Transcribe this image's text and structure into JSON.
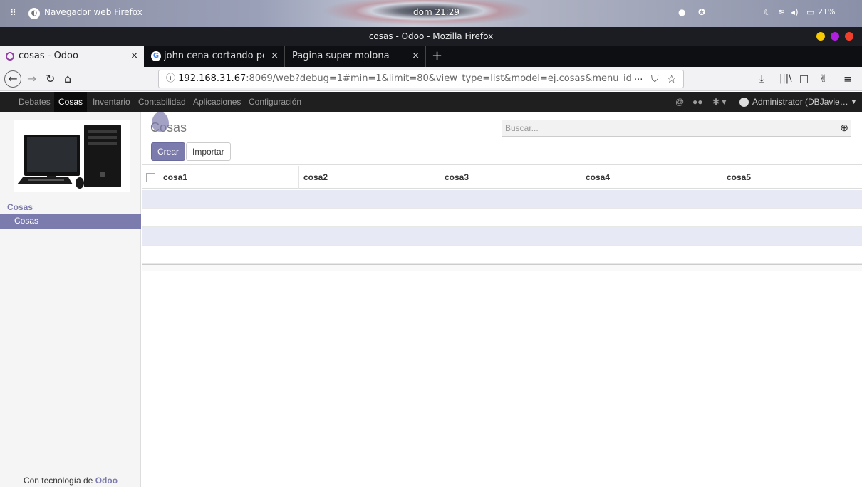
{
  "os_bar": {
    "activities_icon": "grid-icon",
    "app_name": "Navegador web Firefox",
    "clock": "dom 21:29",
    "battery": "21%"
  },
  "window": {
    "title": "cosas - Odoo - Mozilla Firefox",
    "buttons": {
      "minimize_color": "#f6c900",
      "maximize_color": "#b01fe0",
      "close_color": "#f0402b"
    }
  },
  "tabs": [
    {
      "label": "cosas - Odoo",
      "close": "×"
    },
    {
      "label": "john cena cortando pelo",
      "close": "×"
    },
    {
      "label": "Pagina super molona",
      "close": "×"
    }
  ],
  "new_tab": "+",
  "address": {
    "info_icon": "ⓘ",
    "host": "192.168.31.67",
    "rest": ":8069/web?debug=1#min=1&limit=80&view_type=list&model=ej.cosas&menu_id",
    "more": "···"
  },
  "odoo_menu": {
    "items": [
      "Debates",
      "Cosas",
      "Inventario",
      "Contabilidad",
      "Aplicaciones",
      "Configuración"
    ],
    "user": "Administrator (DBJavie…"
  },
  "sidebar": {
    "section": "Cosas",
    "item": "Cosas",
    "footer_prefix": "Con tecnología de",
    "footer_brand": "Odoo"
  },
  "control_panel": {
    "breadcrumb": "Cosas",
    "search_placeholder": "Buscar...",
    "create_label": "Crear",
    "import_label": "Importar"
  },
  "list": {
    "columns": [
      "cosa1",
      "cosa2",
      "cosa3",
      "cosa4",
      "cosa5"
    ],
    "empty_rows": 4
  },
  "colors": {
    "accent": "#7c7bad",
    "odoo_nav_bg": "#1f1f1f"
  }
}
